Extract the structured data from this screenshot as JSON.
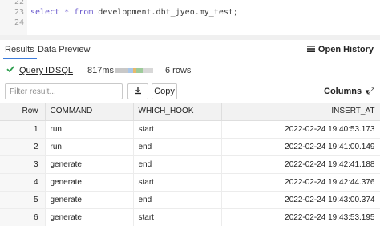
{
  "editor": {
    "lines": [
      {
        "num": "22",
        "keyword": "",
        "text": ""
      },
      {
        "num": "23",
        "keyword": "select * from",
        "text": " development.dbt_jyeo.my_test;"
      },
      {
        "num": "24",
        "keyword": "",
        "text": ""
      }
    ]
  },
  "tabs": {
    "results": "Results",
    "data_preview": "Data Preview",
    "open_history": "Open History"
  },
  "info": {
    "query_id": "Query ID",
    "sql": "SQL",
    "timing": "817ms",
    "rows": "6 rows",
    "progress_segments": [
      {
        "fraction": 0.35,
        "color": "#c8c8c8"
      },
      {
        "fraction": 0.12,
        "color": "#a9c6e8"
      },
      {
        "fraction": 0.1,
        "color": "#e8b86a"
      },
      {
        "fraction": 0.15,
        "color": "#9ecb9a"
      },
      {
        "fraction": 0.28,
        "color": "#d8d8d8"
      }
    ],
    "status_color": "#2e9e4f"
  },
  "toolbar": {
    "filter_placeholder": "Filter result...",
    "download_icon": "download-icon",
    "copy_label": "Copy",
    "columns_label": "Columns",
    "expand_icon": "expand-icon"
  },
  "table": {
    "headers": [
      "Row",
      "COMMAND",
      "WHICH_HOOK",
      "INSERT_AT"
    ],
    "rows": [
      [
        "1",
        "run",
        "start",
        "2022-02-24 19:40:53.173"
      ],
      [
        "2",
        "run",
        "end",
        "2022-02-24 19:41:00.149"
      ],
      [
        "3",
        "generate",
        "end",
        "2022-02-24 19:42:41.188"
      ],
      [
        "4",
        "generate",
        "start",
        "2022-02-24 19:42:44.376"
      ],
      [
        "5",
        "generate",
        "end",
        "2022-02-24 19:43:00.374"
      ],
      [
        "6",
        "generate",
        "start",
        "2022-02-24 19:43:53.195"
      ]
    ]
  }
}
